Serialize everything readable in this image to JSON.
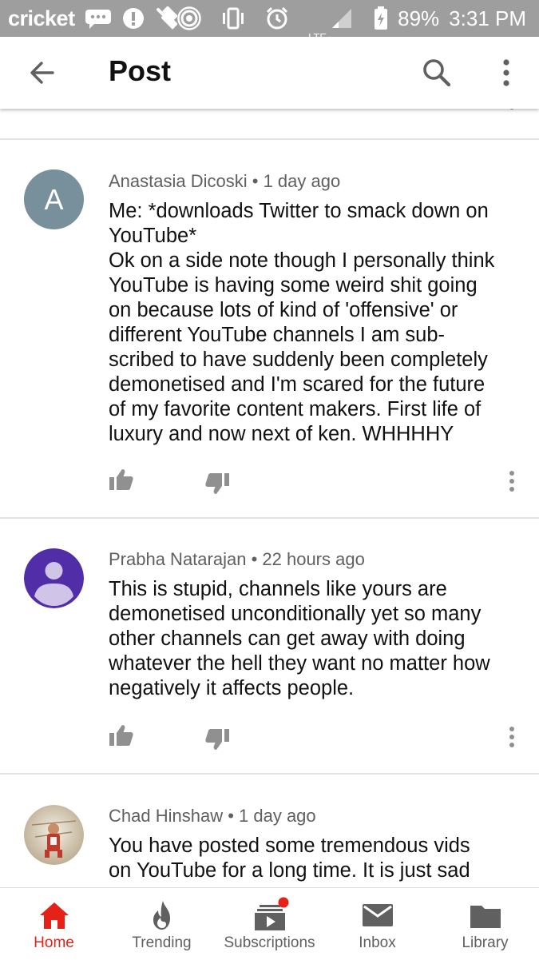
{
  "status_bar": {
    "carrier": "cricket",
    "battery": "89%",
    "time": "3:31 PM",
    "network": "LTE"
  },
  "app_bar": {
    "title": "Post"
  },
  "comments": [
    {
      "author": "Anastasia Dicoski",
      "time": "1 day ago",
      "avatar_letter": "A",
      "avatar_color": "#78909c",
      "text": "Me: *downloads Twitter to smack down on\nYouTube*\nOk on a side note though I personally think\nYouTube is having some weird shit going\non because lots of kind of 'offensive' or\ndifferent YouTube channels I am sub-\nscribed to have suddenly been completely\ndemonetised and I'm scared for the future\nof my favorite content makers. First life of\nluxury and now next of ken. WHHHHY"
    },
    {
      "author": "Prabha Natarajan",
      "time": "22 hours ago",
      "avatar_color": "#512da8",
      "text": "This is stupid, channels like yours are\ndemonetised unconditionally yet so many\nother channels can get away with doing\nwhatever the hell they want no matter how\nnegatively it affects people."
    },
    {
      "author": "Chad Hinshaw",
      "time": "1 day ago",
      "text": "You have posted some tremendous vids\non YouTube for a long time. It is just sad"
    }
  ],
  "bottom_nav": [
    {
      "label": "Home",
      "icon": "home-icon",
      "active": true
    },
    {
      "label": "Trending",
      "icon": "flame-icon"
    },
    {
      "label": "Subscriptions",
      "icon": "subscriptions-icon",
      "badge": true
    },
    {
      "label": "Inbox",
      "icon": "mail-icon"
    },
    {
      "label": "Library",
      "icon": "folder-icon"
    }
  ],
  "colors": {
    "accent": "#e62117",
    "icon_gray": "#606060",
    "status_bar": "#9e9e9e"
  }
}
